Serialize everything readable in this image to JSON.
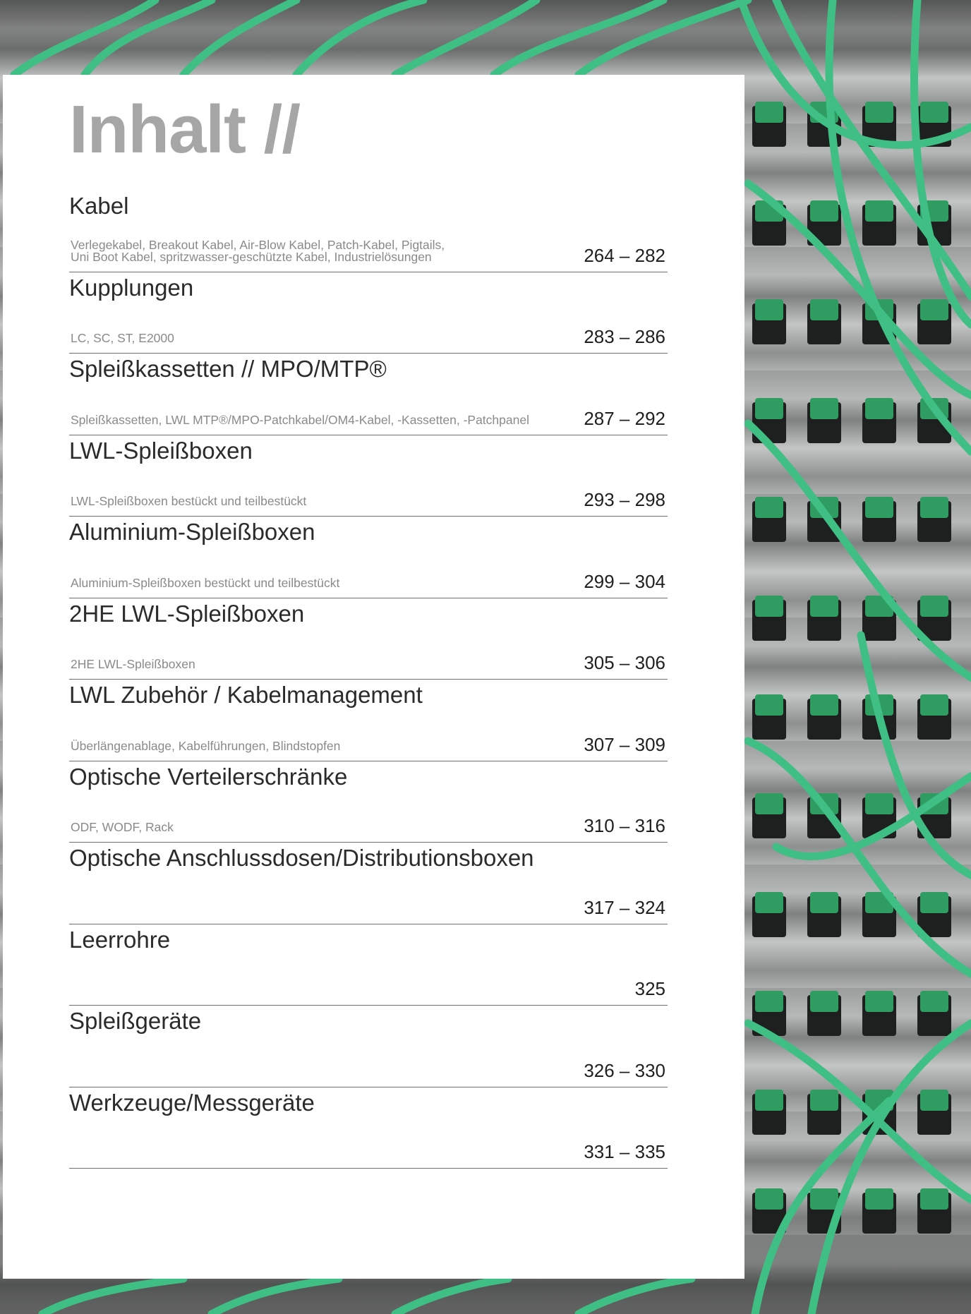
{
  "page_title": "Inhalt //",
  "toc": [
    {
      "heading": "Kabel",
      "sub": "Verlegekabel, Breakout Kabel, Air-Blow Kabel, Patch-Kabel, Pigtails,\nUni Boot Kabel, spritzwasser-geschützte Kabel, Industrielösungen",
      "pages": "264 – 282"
    },
    {
      "heading": "Kupplungen",
      "sub": "LC, SC, ST, E2000",
      "pages": "283 – 286"
    },
    {
      "heading": "Spleißkassetten // MPO/MTP®",
      "sub": "Spleißkassetten, LWL MTP®/MPO-Patchkabel/OM4-Kabel, -Kassetten, -Patchpanel",
      "pages": "287 – 292"
    },
    {
      "heading": "LWL-Spleißboxen",
      "sub": "LWL-Spleißboxen bestückt und teilbestückt",
      "pages": "293 – 298"
    },
    {
      "heading": "Aluminium-Spleißboxen",
      "sub": "Aluminium-Spleißboxen bestückt und teilbestückt",
      "pages": "299 – 304"
    },
    {
      "heading": "2HE LWL-Spleißboxen",
      "sub": "2HE LWL-Spleißboxen",
      "pages": "305 – 306"
    },
    {
      "heading": "LWL Zubehör / Kabelmanagement",
      "sub": "Überlängenablage, Kabelführungen, Blindstopfen",
      "pages": "307 – 309"
    },
    {
      "heading": "Optische Verteilerschränke",
      "sub": "ODF, WODF, Rack",
      "pages": "310 – 316"
    },
    {
      "heading": "Optische Anschlussdosen/Distributionsboxen",
      "sub": "",
      "pages": "317 – 324"
    },
    {
      "heading": "Leerrohre",
      "sub": "",
      "pages": "325"
    },
    {
      "heading": "Spleißgeräte",
      "sub": "",
      "pages": "326 – 330"
    },
    {
      "heading": "Werkzeuge/Messgeräte",
      "sub": "",
      "pages": "331 – 335"
    }
  ],
  "colors": {
    "cable_green": "#3fbf83",
    "title_gray": "#a6a6a6"
  }
}
